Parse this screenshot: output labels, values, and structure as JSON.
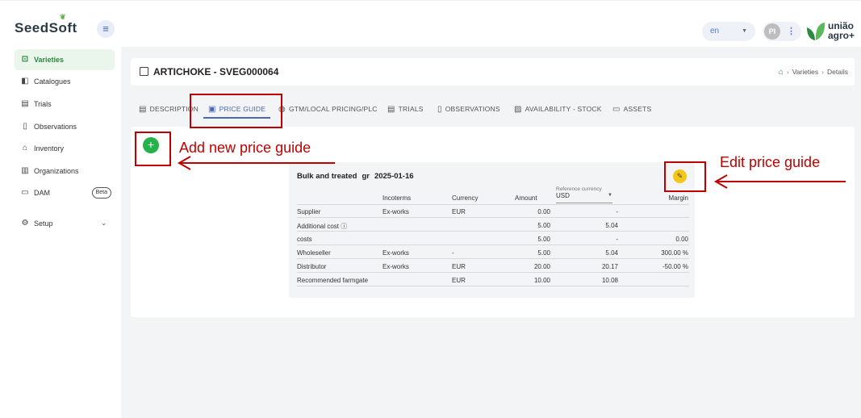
{
  "app": {
    "logo_text": "SeedSoft",
    "menu_icon": "hamburger-icon",
    "language": "en",
    "user_initials": "PI",
    "brand_line1": "união",
    "brand_line2": "agro+"
  },
  "sidebar": {
    "items": [
      {
        "label": "Varieties",
        "icon": "seed-icon",
        "active": true
      },
      {
        "label": "Catalogues",
        "icon": "catalogue-icon"
      },
      {
        "label": "Trials",
        "icon": "clipboard-icon"
      },
      {
        "label": "Observations",
        "icon": "notebook-icon"
      },
      {
        "label": "Inventory",
        "icon": "warehouse-icon"
      },
      {
        "label": "Organizations",
        "icon": "building-icon"
      },
      {
        "label": "DAM",
        "icon": "folder-icon",
        "badge": "Beta"
      },
      {
        "label": "Setup",
        "icon": "gear-icon"
      }
    ]
  },
  "header": {
    "title": "ARTICHOKE - SVEG000064",
    "breadcrumb": [
      "Varieties",
      "Details"
    ]
  },
  "tabs": [
    {
      "label": "DESCRIPTION",
      "icon": "document-icon"
    },
    {
      "label": "PRICE GUIDE",
      "icon": "price-tag-icon",
      "active": true
    },
    {
      "label": "GTM/LOCAL PRICING/PLC",
      "icon": "globe-icon"
    },
    {
      "label": "TRIALS",
      "icon": "clipboard-icon"
    },
    {
      "label": "OBSERVATIONS",
      "icon": "notebook-icon"
    },
    {
      "label": "AVAILABILITY - STOCK",
      "icon": "clipboard-check-icon"
    },
    {
      "label": "ASSETS",
      "icon": "folder-icon"
    }
  ],
  "price_guide": {
    "name": "Bulk and treated",
    "unit": "gr",
    "date": "2025-01-16",
    "reference_currency_label": "Reference currency",
    "reference_currency": "USD",
    "columns": {
      "incoterms": "Incoterms",
      "currency": "Currency",
      "amount": "Amount",
      "margin": "Margin"
    },
    "rows": [
      {
        "label": "Supplier",
        "incoterms": "Ex-works",
        "currency": "EUR",
        "amount": "0.00",
        "ref": "-",
        "margin": ""
      },
      {
        "label": "Additional cost",
        "info": "ⓘ",
        "incoterms": "",
        "currency": "",
        "amount": "5.00",
        "ref": "5.04",
        "margin": ""
      },
      {
        "label": "costs",
        "incoterms": "",
        "currency": "",
        "amount": "5.00",
        "ref": "-",
        "margin": "0.00"
      },
      {
        "label": "Wholeseller",
        "incoterms": "Ex-works",
        "currency": "-",
        "amount": "5.00",
        "ref": "5.04",
        "margin": "300.00 %"
      },
      {
        "label": "Distributor",
        "incoterms": "Ex-works",
        "currency": "EUR",
        "amount": "20.00",
        "ref": "20.17",
        "margin": "-50.00 %"
      },
      {
        "label": "Recommended farmgate",
        "incoterms": "",
        "currency": "EUR",
        "amount": "10.00",
        "ref": "10.08",
        "margin": ""
      }
    ]
  },
  "annotations": {
    "add": "Add new price guide",
    "edit": "Edit price guide",
    "color": "#c00000"
  },
  "colors": {
    "accent_green": "#26b24b",
    "accent_blue": "#4a67b0",
    "edit_yellow": "#f5c518"
  }
}
